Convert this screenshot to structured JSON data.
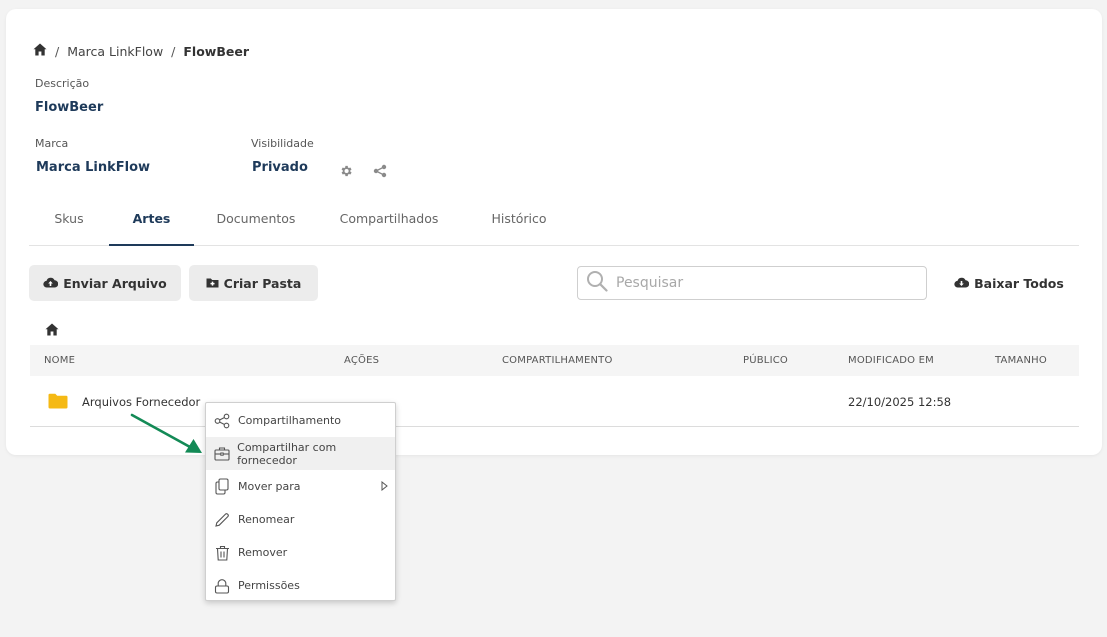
{
  "breadcrumb": {
    "home_icon": "home-icon",
    "level1": "Marca LinkFlow",
    "current": "FlowBeer"
  },
  "details": {
    "descricao_label": "Descrição",
    "descricao_value": "FlowBeer",
    "marca_label": "Marca",
    "marca_value": "Marca LinkFlow",
    "visibilidade_label": "Visibilidade",
    "visibilidade_value": "Privado"
  },
  "tabs": [
    {
      "label": "Skus",
      "active": false
    },
    {
      "label": "Artes",
      "active": true
    },
    {
      "label": "Documentos",
      "active": false
    },
    {
      "label": "Compartilhados",
      "active": false
    },
    {
      "label": "Histórico",
      "active": false
    }
  ],
  "toolbar": {
    "upload_label": "Enviar Arquivo",
    "create_folder_label": "Criar Pasta",
    "search_placeholder": "Pesquisar",
    "download_all_label": "Baixar Todos"
  },
  "table": {
    "headers": [
      "NOME",
      "AÇÕES",
      "COMPARTILHAMENTO",
      "PÚBLICO",
      "MODIFICADO EM",
      "TAMANHO"
    ],
    "rows": [
      {
        "name": "Arquivos Fornecedor",
        "modified": "22/10/2025 12:58"
      }
    ]
  },
  "context_menu": {
    "items": [
      {
        "label": "Compartilhamento",
        "icon": "share-icon"
      },
      {
        "label": "Compartilhar com fornecedor",
        "icon": "briefcase-icon"
      },
      {
        "label": "Mover para",
        "icon": "copy-icon"
      },
      {
        "label": "Renomear",
        "icon": "pencil-icon"
      },
      {
        "label": "Remover",
        "icon": "trash-icon"
      },
      {
        "label": "Permissões",
        "icon": "lock-icon"
      }
    ]
  },
  "colors": {
    "accent": "#1e3a5a",
    "folder": "#f5b914",
    "arrow": "#138a56"
  }
}
